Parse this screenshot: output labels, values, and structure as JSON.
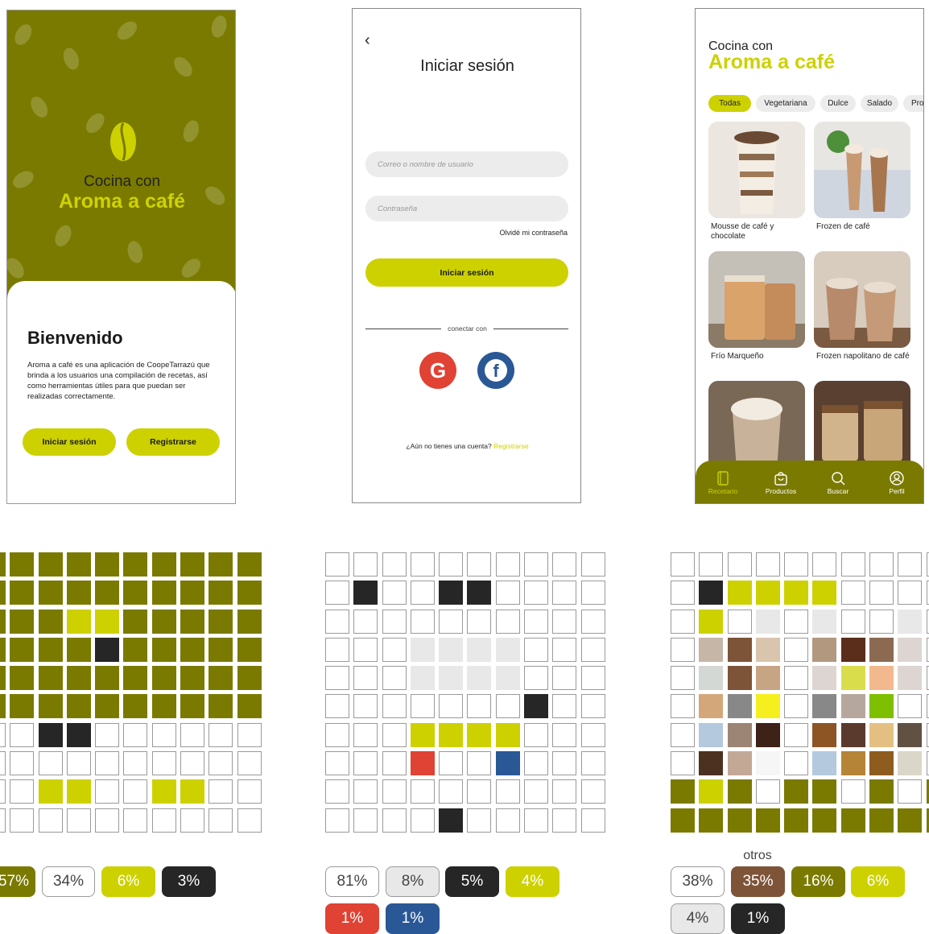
{
  "colors": {
    "olive": "#7a7a00",
    "lime": "#cdd100",
    "dark": "#262626",
    "light_gray": "#e8e8e8",
    "white": "#ffffff",
    "red": "#e04234",
    "blue": "#2a5896",
    "brown": "#7e5439"
  },
  "welcome": {
    "brand_line1": "Cocina con",
    "brand_line2": "Aroma a café",
    "title": "Bienvenido",
    "description": "Aroma a café es una aplicación de CoopeTarrazú que brinda a los usuarios una compilación de recetas, así como herramientas útiles para que puedan ser realizadas correctamente.",
    "login_label": "Iniciar sesión",
    "register_label": "Registrarse"
  },
  "login": {
    "back_glyph": "‹",
    "title": "Iniciar sesión",
    "user_placeholder": "Correo o nombre de usuario",
    "password_placeholder": "Contraseña",
    "forgot_label": "Olvidé mi contraseña",
    "submit_label": "Iniciar sesión",
    "connect_label": "conectar con",
    "google_glyph": "G",
    "facebook_glyph": "f",
    "no_account_text": "¿Aún no tienes una cuenta? ",
    "register_link": "Registrarse"
  },
  "recipes": {
    "brand_line1": "Cocina con",
    "brand_line2": "Aroma a café",
    "filters": [
      "Todas",
      "Vegetariana",
      "Dulce",
      "Salado",
      "Pro"
    ],
    "cards": [
      {
        "label": "Mousse de café y chocolate"
      },
      {
        "label": "Frozen de café"
      },
      {
        "label": "Frío Marqueño"
      },
      {
        "label": "Frozen napolitano de café"
      },
      {
        "label": ""
      },
      {
        "label": ""
      }
    ],
    "nav": [
      {
        "label": "Recetario",
        "icon": "book-icon"
      },
      {
        "label": "Productos",
        "icon": "bag-icon"
      },
      {
        "label": "Buscar",
        "icon": "search-icon"
      },
      {
        "label": "Perfil",
        "icon": "profile-icon"
      }
    ]
  },
  "palette1": {
    "badges": [
      {
        "label": "57%",
        "bg": "#7a7a00",
        "fg": "#ffffff"
      },
      {
        "label": "34%",
        "bg": "#ffffff",
        "fg": "#444444"
      },
      {
        "label": "6%",
        "bg": "#cdd100",
        "fg": "#ffffff"
      },
      {
        "label": "3%",
        "bg": "#262626",
        "fg": "#ffffff"
      }
    ]
  },
  "palette2": {
    "badges": [
      {
        "label": "81%",
        "bg": "#ffffff",
        "fg": "#444444"
      },
      {
        "label": "8%",
        "bg": "#e8e8e8",
        "fg": "#444444"
      },
      {
        "label": "5%",
        "bg": "#262626",
        "fg": "#ffffff"
      },
      {
        "label": "4%",
        "bg": "#cdd100",
        "fg": "#ffffff"
      },
      {
        "label": "1%",
        "bg": "#e04234",
        "fg": "#ffffff"
      },
      {
        "label": "1%",
        "bg": "#2a5896",
        "fg": "#ffffff"
      }
    ]
  },
  "palette3": {
    "others_label": "otros",
    "badges": [
      {
        "label": "38%",
        "bg": "#ffffff",
        "fg": "#444444"
      },
      {
        "label": "35%",
        "bg": "#7e5439",
        "fg": "#ffffff"
      },
      {
        "label": "16%",
        "bg": "#7a7a00",
        "fg": "#ffffff"
      },
      {
        "label": "6%",
        "bg": "#cdd100",
        "fg": "#ffffff"
      },
      {
        "label": "4%",
        "bg": "#e8e8e8",
        "fg": "#444444"
      },
      {
        "label": "1%",
        "bg": "#262626",
        "fg": "#ffffff"
      }
    ]
  },
  "grids": {
    "legend": {
      "O": "#7a7a00",
      "L": "#cdd100",
      "D": "#262626",
      "W": "#ffffff",
      "G": "#e8e8e8",
      "R": "#e04234",
      "B": "#2a5896",
      "a": "#c6b6a8",
      "b": "#7e5439",
      "c": "#d9c5ad",
      "d": "#b39880",
      "e": "#5a2e1b",
      "f": "#8c6a52",
      "g": "#ddd5d2",
      "h": "#d3d8d4",
      "i": "#c7a483",
      "j": "#d9dd4c",
      "k": "#f2b98f",
      "l": "#d3a77a",
      "m": "#888888",
      "n": "#f5ef1e",
      "o": "#b6a79e",
      "p": "#7ebf00",
      "q": "#b4c8de",
      "r": "#9c8574",
      "s": "#3d2218",
      "t": "#8c5523",
      "u": "#5a3a2c",
      "v": "#e3c082",
      "w": "#615142",
      "x": "#4c3020",
      "y": "#c3a896",
      "z": "#f6f6f6",
      "A": "#b68437",
      "C": "#8f5c20",
      "E": "#dad6c9"
    },
    "grid1": [
      "OOOOOOOOOO",
      "OOOOOOOOOO",
      "OOOLLOOOOO",
      "OOOODOOOOO",
      "OOOOOOOOOO",
      "OOOOOOOOOO",
      "WWDDWWWWWW",
      "WWWWWWWWWW",
      "WWLLWWLLWW",
      "WWWWWWWWWW"
    ],
    "grid2": [
      "WWWWWWWWWW",
      "WDWWDDWWWW",
      "WWWWWWWWWW",
      "WWWGGGGWWW",
      "WWWGGGGWWW",
      "WWWWWWWDWW",
      "WWWLLLLWWW",
      "WWWRWWBWWW",
      "WWWWWWWWWW",
      "WWWWDWWWWW"
    ],
    "grid3": [
      "WWWWWWWWWW",
      "WDLLLLWWWW",
      "WLWGWGWWGW",
      "WabcWdefgW",
      "WhbiWgjkgW",
      "WlmnWmopWW",
      "WqrsWtuvwW",
      "WxyzWqACEW",
      "OLOWOOWOWO",
      "OOOOOOOOOO"
    ]
  }
}
